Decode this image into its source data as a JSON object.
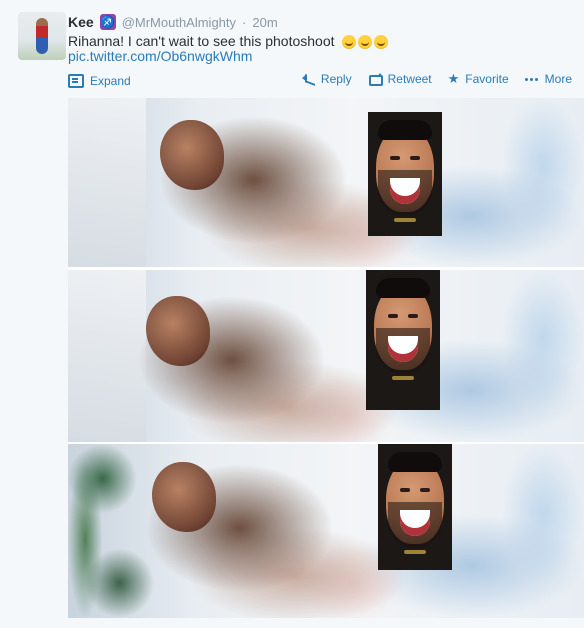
{
  "tweet": {
    "user": {
      "name": "Kee",
      "badge_icon": "sagittarius-icon",
      "handle": "@MrMouthAlmighty",
      "separator": "·",
      "time": "20m"
    },
    "text": "Rihanna! I can't wait to see this photoshoot",
    "emojis": [
      "heart-eyes-emoji",
      "winking-tongue-emoji",
      "wink-emoji"
    ],
    "link": "pic.twitter.com/Ob6nwgkWhm",
    "expand_label": "Expand",
    "actions": {
      "reply": "Reply",
      "retweet": "Retweet",
      "favorite": "Favorite",
      "more": "More"
    }
  },
  "colors": {
    "link_blue": "#2b7bb9",
    "meta_gray": "#8899a6",
    "text_dark": "#292f33",
    "badge_purple": "#8e44ad"
  }
}
